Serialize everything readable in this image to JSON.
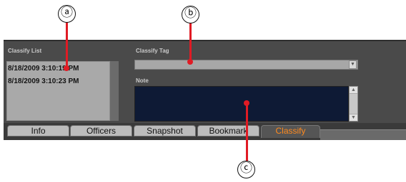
{
  "classify_list": {
    "label": "Classify List",
    "items": [
      "8/18/2009 3:10:19 PM",
      "8/18/2009 3:10:23 PM"
    ]
  },
  "classify_tag": {
    "label": "Classify Tag",
    "value": ""
  },
  "note": {
    "label": "Note",
    "value": ""
  },
  "tabs": [
    {
      "label": "Info",
      "active": false
    },
    {
      "label": "Officers",
      "active": false
    },
    {
      "label": "Snapshot",
      "active": false
    },
    {
      "label": "Bookmark",
      "active": false
    },
    {
      "label": "Classify",
      "active": true
    }
  ],
  "callouts": {
    "a": "ⓐ",
    "b": "ⓑ",
    "c": "ⓒ"
  },
  "colors": {
    "active_tab_text": "#ff8a1e",
    "leader": "#e01b24",
    "note_bg": "#0e1a35"
  }
}
